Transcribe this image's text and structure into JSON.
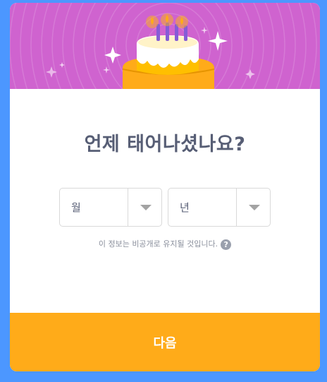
{
  "dialog": {
    "title": "언제 태어나셨나요?",
    "month_select": {
      "value": "월"
    },
    "year_select": {
      "value": "년"
    },
    "privacy_note": "이 정보는 비공개로 유지될 것입니다.",
    "help_glyph": "?",
    "next_label": "다음"
  },
  "colors": {
    "background": "#4c97ff",
    "banner": "#cf63cf",
    "heading": "#575e75",
    "button": "#ffab19",
    "cake_top": "#ffbf00",
    "cake_body": "#ffab19"
  },
  "icons": {
    "cake": "birthday-cake-icon",
    "sparkle": "sparkle-icon",
    "dropdown": "chevron-down-icon",
    "help": "question-circle-icon"
  }
}
